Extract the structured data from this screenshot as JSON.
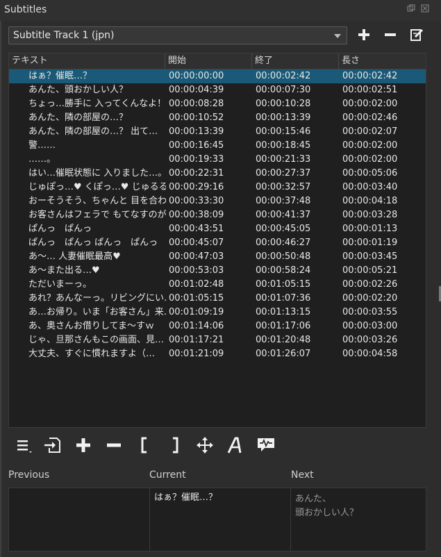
{
  "window": {
    "title": "Subtitles"
  },
  "track_selector": {
    "value": "Subtitle Track 1 (jpn)"
  },
  "table": {
    "columns": [
      "テキスト",
      "開始",
      "終了",
      "長さ"
    ],
    "rows": [
      [
        "はぁ？催眠…？",
        "00:00:00:00",
        "00:00:02:42",
        "00:00:02:42"
      ],
      [
        "あんた、頭おかしい人？",
        "00:00:04:39",
        "00:00:07:30",
        "00:00:02:51"
      ],
      [
        "ちょっ…勝手に 入ってくんなよ！",
        "00:00:08:28",
        "00:00:10:28",
        "00:00:02:00"
      ],
      [
        "あんた、隣の部屋の…？",
        "00:00:10:52",
        "00:00:13:39",
        "00:00:02:46"
      ],
      [
        "あんた、隣の部屋の…？ 出て…",
        "00:00:13:39",
        "00:00:15:46",
        "00:00:02:07"
      ],
      [
        "警……",
        "00:00:16:45",
        "00:00:18:45",
        "00:00:02:00"
      ],
      [
        "……。",
        "00:00:19:33",
        "00:00:21:33",
        "00:00:02:00"
      ],
      [
        "はい…催眠状態に 入りました…。",
        "00:00:22:31",
        "00:00:27:37",
        "00:00:05:06"
      ],
      [
        "じゅぽっ…♥ くぽっ…♥ じゅるる…",
        "00:00:29:16",
        "00:00:32:57",
        "00:00:03:40"
      ],
      [
        "おーそうそう、ちゃんと 目を合わ…",
        "00:00:33:30",
        "00:00:37:48",
        "00:00:04:18"
      ],
      [
        "お客さんはフェラで もてなすのが…",
        "00:00:38:09",
        "00:00:41:37",
        "00:00:03:28"
      ],
      [
        "ぱんっ　ぱんっ",
        "00:00:43:51",
        "00:00:45:05",
        "00:00:01:13"
      ],
      [
        "ぱんっ　ぱんっ ぱんっ　ぱんっ",
        "00:00:45:07",
        "00:00:46:27",
        "00:00:01:19"
      ],
      [
        "あ〜… 人妻催眠最高♥",
        "00:00:47:03",
        "00:00:50:48",
        "00:00:03:45"
      ],
      [
        "あ〜また出る…♥",
        "00:00:53:03",
        "00:00:58:24",
        "00:00:05:21"
      ],
      [
        "ただいまーっ。",
        "00:01:02:48",
        "00:01:05:15",
        "00:00:02:26"
      ],
      [
        "あれ？あんなーっ。リビングにい…",
        "00:01:05:15",
        "00:01:07:36",
        "00:00:02:20"
      ],
      [
        "あ…お帰り。いま「お客さん」来…",
        "00:01:09:19",
        "00:01:13:15",
        "00:00:03:55"
      ],
      [
        "あ、奥さんお借りしてま〜すｗ",
        "00:01:14:06",
        "00:01:17:06",
        "00:00:03:00"
      ],
      [
        "じゃ、旦那さんもこの画面、見…",
        "00:01:17:21",
        "00:01:20:48",
        "00:00:03:26"
      ],
      [
        "大丈夫、すぐに慣れますよ（…",
        "00:01:21:09",
        "00:01:26:07",
        "00:00:04:58"
      ]
    ],
    "selected_index": 0
  },
  "preview": {
    "previous_label": "Previous",
    "current_label": "Current",
    "next_label": "Next",
    "previous_text": "",
    "current_text": "はぁ？催眠…？",
    "next_text": "あんた、\n頭おかしい人？"
  },
  "icons": {
    "menu": "menu-icon",
    "import": "import-icon",
    "add": "plus-icon",
    "remove": "minus-icon",
    "set_start": "bracket-left-icon",
    "set_end": "bracket-right-icon",
    "move": "move-icon",
    "text": "text-icon",
    "speech": "speech-icon"
  },
  "colors": {
    "selection": "#1a5a78",
    "background": "#2d2d2d",
    "list_bg": "#1f1f1f"
  }
}
